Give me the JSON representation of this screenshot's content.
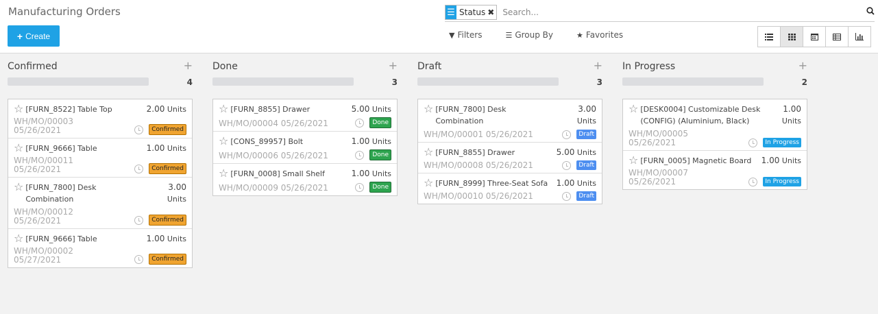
{
  "header": {
    "title": "Manufacturing Orders",
    "create_label": "Create"
  },
  "search": {
    "facet_label": "Status",
    "placeholder": "Search..."
  },
  "filters": {
    "filters_label": "Filters",
    "group_by_label": "Group By",
    "favorites_label": "Favorites"
  },
  "views": [
    "list",
    "kanban",
    "calendar",
    "pivot",
    "graph"
  ],
  "columns": [
    {
      "title": "Confirmed",
      "count": "4",
      "cards": [
        {
          "name": "[FURN_8522] Table Top",
          "qty": "2.00",
          "unit": "Units",
          "ref": "WH/MO/00003",
          "date": "05/26/2021",
          "status": "Confirmed"
        },
        {
          "name": "[FURN_9666] Table",
          "qty": "1.00",
          "unit": "Units",
          "ref": "WH/MO/00011",
          "date": "05/26/2021",
          "status": "Confirmed"
        },
        {
          "name": "[FURN_7800] Desk",
          "name2": "Combination",
          "qty": "3.00",
          "unit": "Units",
          "ref": "WH/MO/00012",
          "date": "05/26/2021",
          "status": "Confirmed"
        },
        {
          "name": "[FURN_9666] Table",
          "qty": "1.00",
          "unit": "Units",
          "ref": "WH/MO/00002",
          "date": "05/27/2021",
          "status": "Confirmed"
        }
      ]
    },
    {
      "title": "Done",
      "count": "3",
      "cards": [
        {
          "name": "[FURN_8855] Drawer",
          "qty": "5.00",
          "unit": "Units",
          "ref": "WH/MO/00004",
          "date": "05/26/2021",
          "status": "Done"
        },
        {
          "name": "[CONS_89957] Bolt",
          "qty": "1.00",
          "unit": "Units",
          "ref": "WH/MO/00006",
          "date": "05/26/2021",
          "status": "Done"
        },
        {
          "name": "[FURN_0008] Small Shelf",
          "qty": "1.00",
          "unit": "Units",
          "ref": "WH/MO/00009",
          "date": "05/26/2021",
          "status": "Done"
        }
      ]
    },
    {
      "title": "Draft",
      "count": "3",
      "cards": [
        {
          "name": "[FURN_7800] Desk",
          "name2": "Combination",
          "qty": "3.00",
          "unit": "Units",
          "ref": "WH/MO/00001",
          "date": "05/26/2021",
          "status": "Draft"
        },
        {
          "name": "[FURN_8855] Drawer",
          "qty": "5.00",
          "unit": "Units",
          "ref": "WH/MO/00008",
          "date": "05/26/2021",
          "status": "Draft"
        },
        {
          "name": "[FURN_8999] Three-Seat Sofa",
          "qty": "1.00",
          "unit": "Units",
          "ref": "WH/MO/00010",
          "date": "05/26/2021",
          "status": "Draft"
        }
      ]
    },
    {
      "title": "In Progress",
      "count": "2",
      "cards": [
        {
          "name": "[DESK0004] Customizable Desk",
          "name2": "(CONFIG) (Aluminium, Black)",
          "qty": "1.00",
          "unit": "Units",
          "ref": "WH/MO/00005",
          "date": "05/26/2021",
          "status": "In Progress"
        },
        {
          "name": "[FURN_0005] Magnetic Board",
          "qty": "1.00",
          "unit": "Units",
          "ref": "WH/MO/00007",
          "date": "05/26/2021",
          "status": "In Progress"
        }
      ]
    }
  ],
  "colors": {
    "primary": "#1fa2e5",
    "confirmed": "#f0a430",
    "done": "#2ea44f",
    "draft": "#4d8ef0",
    "in_progress": "#1fa2e5"
  }
}
